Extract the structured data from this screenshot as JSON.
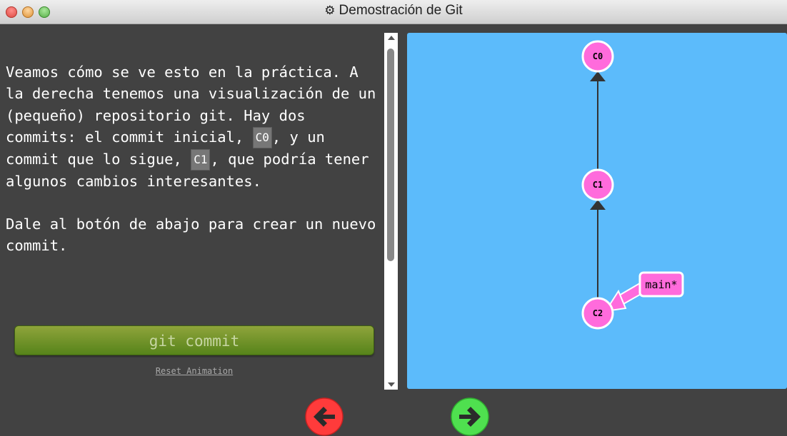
{
  "window": {
    "title": "Demostración de Git",
    "title_icon": "gear-icon"
  },
  "instructions": {
    "p1_part1": "Veamos cómo se ve esto en la práctica. A la derecha tenemos una visualización de un (pequeño) repositorio git. Hay dos commits: el commit inicial, ",
    "chip_c0": "C0",
    "p1_part2": ", y un commit que lo sigue, ",
    "chip_c1": "C1",
    "p1_part3": ", que podría tener algunos cambios interesantes.",
    "p2": "Dale al botón de abajo para crear un nuevo commit.",
    "commit_button": "git commit",
    "reset_link": "Reset Animation"
  },
  "graph": {
    "background": "#5cbbfb",
    "commit_color": "#ff6bdc",
    "commits": [
      {
        "id": "C0",
        "label": "C0"
      },
      {
        "id": "C1",
        "label": "C1"
      },
      {
        "id": "C2",
        "label": "C2"
      }
    ],
    "branch": {
      "label": "main*",
      "target": "C2"
    }
  },
  "nav": {
    "prev_icon": "arrow-left-icon",
    "next_icon": "arrow-right-icon",
    "prev_color": "#ff3b3b",
    "next_color": "#4fe04f"
  }
}
